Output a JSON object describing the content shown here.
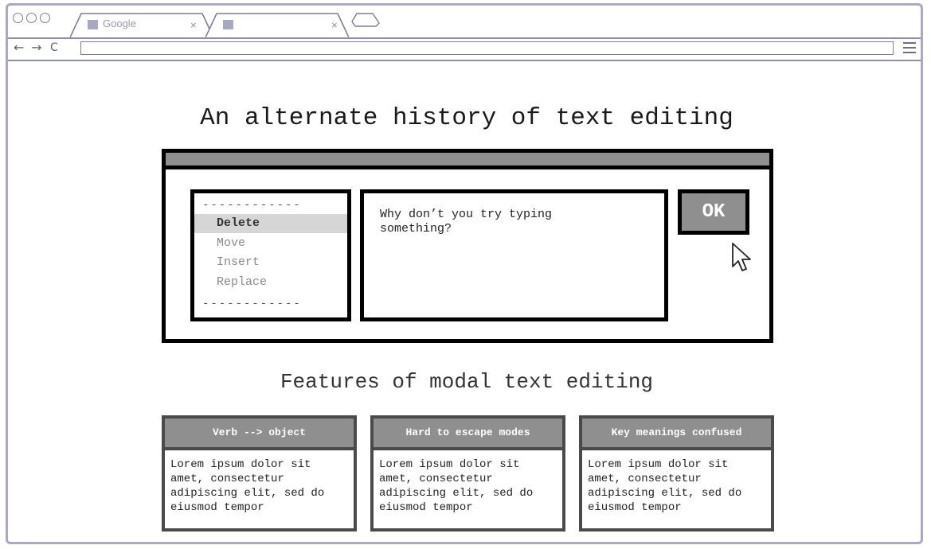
{
  "browser": {
    "tabs": [
      {
        "label": "Google",
        "close": "×"
      },
      {
        "label": "",
        "close": "×"
      }
    ],
    "nav": {
      "back": "←",
      "forward": "→",
      "reload": "C"
    },
    "url": ""
  },
  "page": {
    "title": "An alternate history of text editing",
    "dialog": {
      "menu_items": [
        "Delete",
        "Move",
        "Insert",
        "Replace"
      ],
      "selected_item": "Delete",
      "separator": "------------",
      "text_content": "Why don’t you try typing\nsomething?",
      "ok_label": "OK"
    },
    "features_heading": "Features of modal text editing",
    "cards": [
      {
        "title": "Verb --> object",
        "body": "Lorem ipsum dolor sit\namet, consectetur\nadipiscing elit, sed do\neiusmod tempor"
      },
      {
        "title": "Hard to escape modes",
        "body": "Lorem ipsum dolor sit\namet, consectetur\nadipiscing elit, sed do\neiusmod tempor"
      },
      {
        "title": "Key meanings confused",
        "body": "Lorem ipsum dolor sit\namet, consectetur\nadipiscing elit, sed do\neiusmod tempor"
      }
    ]
  },
  "icons": {
    "favicon": "square-favicon-icon",
    "menu": "hamburger-menu-icon",
    "cursor": "mouse-pointer-icon"
  },
  "colors": {
    "window_border": "#a9a9c4",
    "panel_gray": "#8f8f8f",
    "selected_row": "#d6d6d6"
  }
}
